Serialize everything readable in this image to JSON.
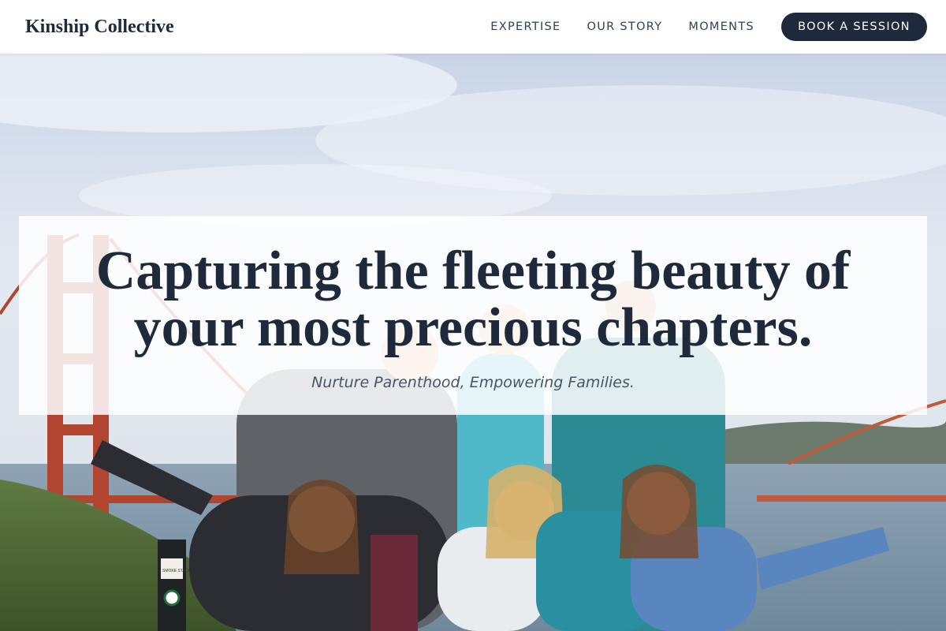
{
  "brand": {
    "name": "Kinship Collective"
  },
  "nav": {
    "links": [
      {
        "label": "EXPERTISE"
      },
      {
        "label": "OUR STORY"
      },
      {
        "label": "MOMENTS"
      }
    ],
    "cta_label": "BOOK A SESSION"
  },
  "hero": {
    "headline": "Capturing the fleeting beauty of your most precious chapters.",
    "subheadline": "Nurture Parenthood, Empowering Families.",
    "photo_sign_text": "SMOKE STACK"
  },
  "colors": {
    "primary": "#1e293b",
    "text_muted": "#475569",
    "header_bg": "#ffffff"
  }
}
